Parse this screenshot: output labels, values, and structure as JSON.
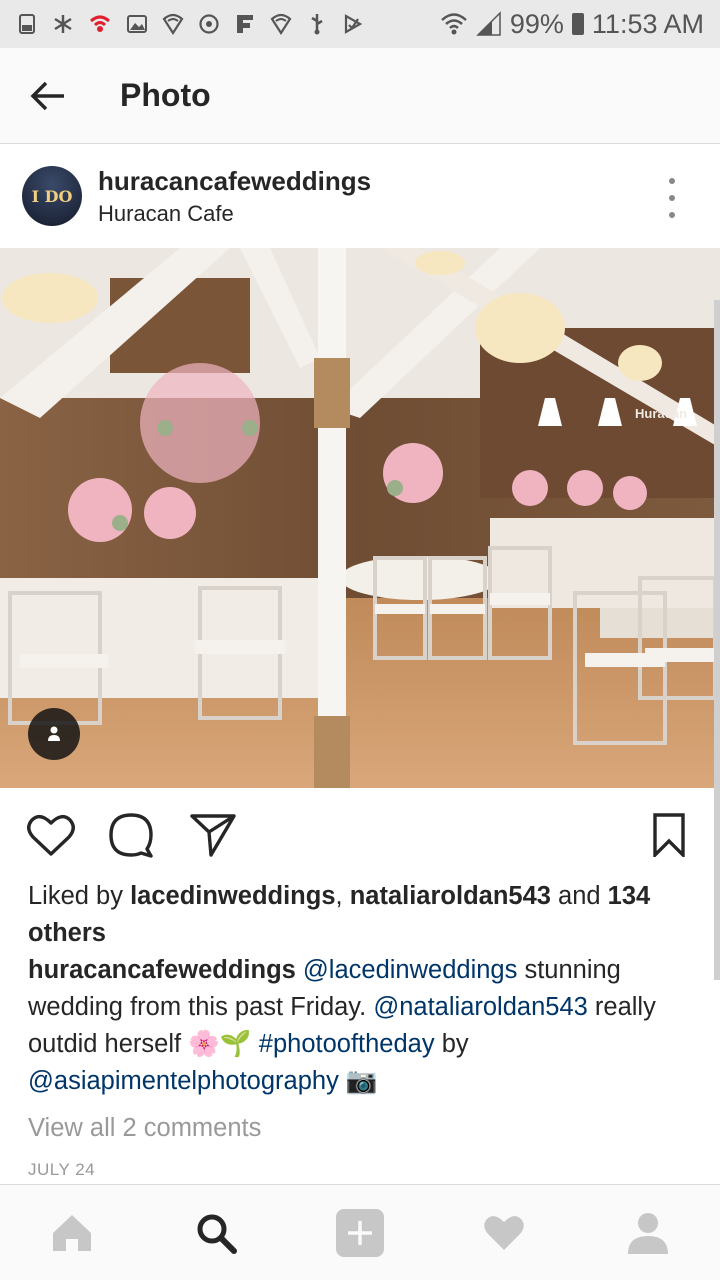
{
  "status_bar": {
    "battery": "99%",
    "time": "11:53 AM",
    "icons": [
      "phone-icon",
      "asterisk-icon",
      "wifi-calling-icon",
      "gallery-icon",
      "shield-icon",
      "sync-icon",
      "app-f-icon",
      "shield-icon",
      "usb-icon",
      "check-icon",
      "wifi-icon",
      "signal-icon",
      "battery-icon"
    ]
  },
  "app_bar": {
    "title": "Photo",
    "back_icon": "arrow-left-icon"
  },
  "post": {
    "username": "huracancafeweddings",
    "location": "Huracan Cafe",
    "avatar_text": "I DO",
    "photo_sign_text": "Huracan",
    "likes": {
      "prefix": "Liked by ",
      "user1": "lacedinweddings",
      "sep": ", ",
      "user2": "nataliaroldan543",
      "and": " and ",
      "count": "134 others"
    },
    "caption": {
      "author": "huracancafeweddings",
      "mention1": "@lacedinweddings",
      "text1": " stunning wedding from this past Friday. ",
      "mention2": "@nataliaroldan543",
      "text2": " really outdid herself 🌸🌱 ",
      "hashtag": "#photooftheday",
      "text3": " by ",
      "mention3": "@asiapimentelphotography",
      "emoji_end": " 📷"
    },
    "view_comments": "View all 2 comments",
    "date": "JULY 24"
  },
  "bottom_nav": [
    "home-icon",
    "search-icon",
    "add-icon",
    "heart-icon",
    "profile-icon"
  ],
  "colors": {
    "link": "#003569",
    "muted": "#999999",
    "text": "#262626"
  }
}
